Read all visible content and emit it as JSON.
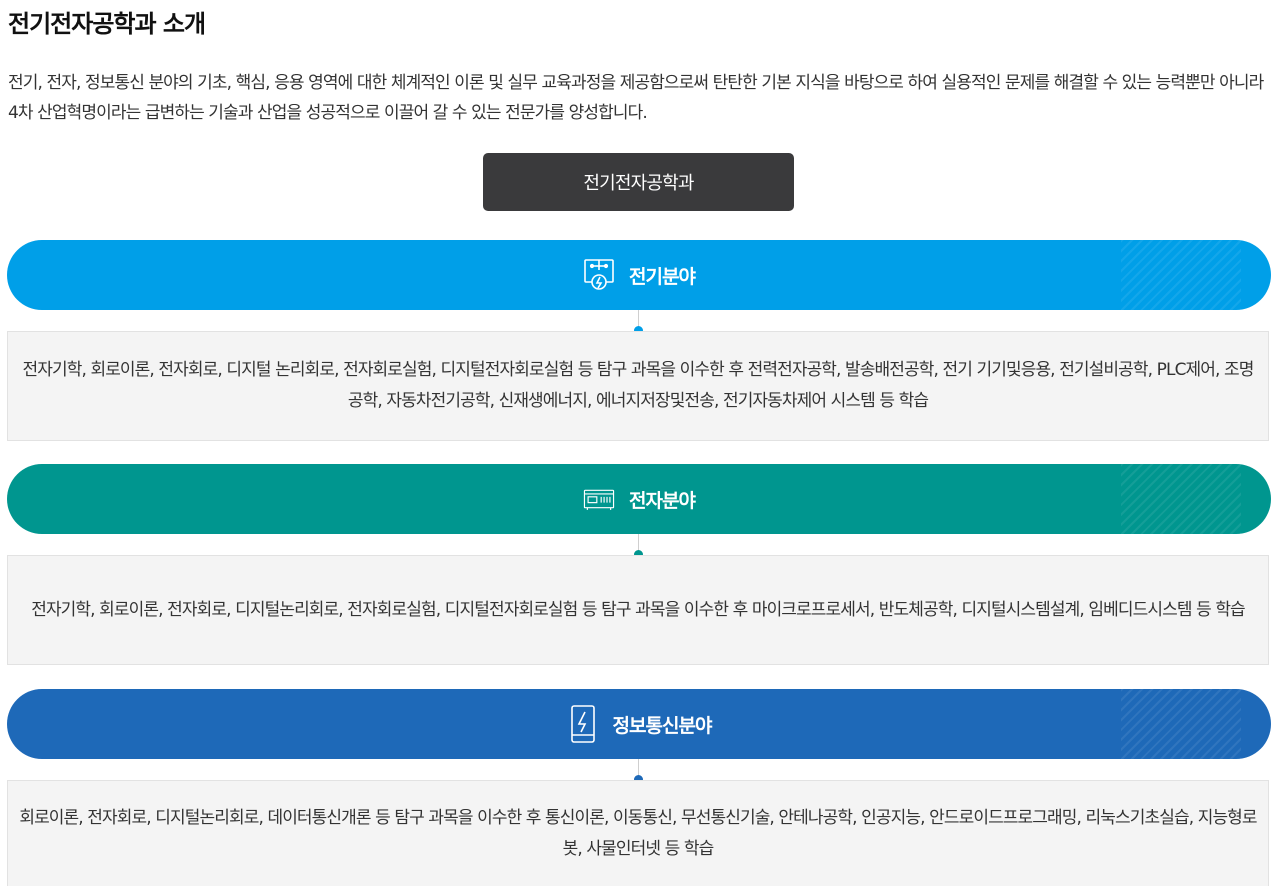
{
  "page": {
    "title": "전기전자공학과 소개",
    "intro": "전기, 전자, 정보통신 분야의 기초, 핵심, 응용 영역에 대한 체계적인 이론 및 실무 교육과정을 제공함으로써 탄탄한 기본 지식을 바탕으로 하여 실용적인 문제를 해결할 수 있는 능력뿐만 아니라 4차 산업혁명이라는 급변하는 기술과 산업을 성공적으로 이끌어 갈 수 있는 전문가를 양성합니다.",
    "department": "전기전자공학과"
  },
  "fields": [
    {
      "name": "전기분야",
      "icon": "circuit-bolt-icon",
      "color": "#009fe8",
      "description": "전자기학, 회로이론, 전자회로, 디지털 논리회로, 전자회로실험, 디지털전자회로실험 등 탐구 과목을 이수한 후 전력전자공학, 발송배전공학, 전기 기기및응용, 전기설비공학, PLC제어, 조명공학, 자동차전기공학, 신재생에너지, 에너지저장및전송, 전기자동차제어 시스템 등 학습"
    },
    {
      "name": "전자분야",
      "icon": "electronic-device-icon",
      "color": "#00968f",
      "description": "전자기학, 회로이론, 전자회로, 디지털논리회로, 전자회로실험, 디지털전자회로실험 등 탐구 과목을 이수한 후 마이크로프로세서, 반도체공학, 디지털시스템설계, 임베디드시스템 등 학습"
    },
    {
      "name": "정보통신분야",
      "icon": "mobile-phone-bolt-icon",
      "color": "#1e69b8",
      "description": "회로이론, 전자회로, 디지털논리회로, 데이터통신개론 등 탐구 과목을 이수한 후 통신이론, 이동통신, 무선통신기술, 안테나공학, 인공지능, 안드로이드프로그래밍, 리눅스기초실습, 지능형로봇, 사물인터넷 등 학습"
    }
  ]
}
